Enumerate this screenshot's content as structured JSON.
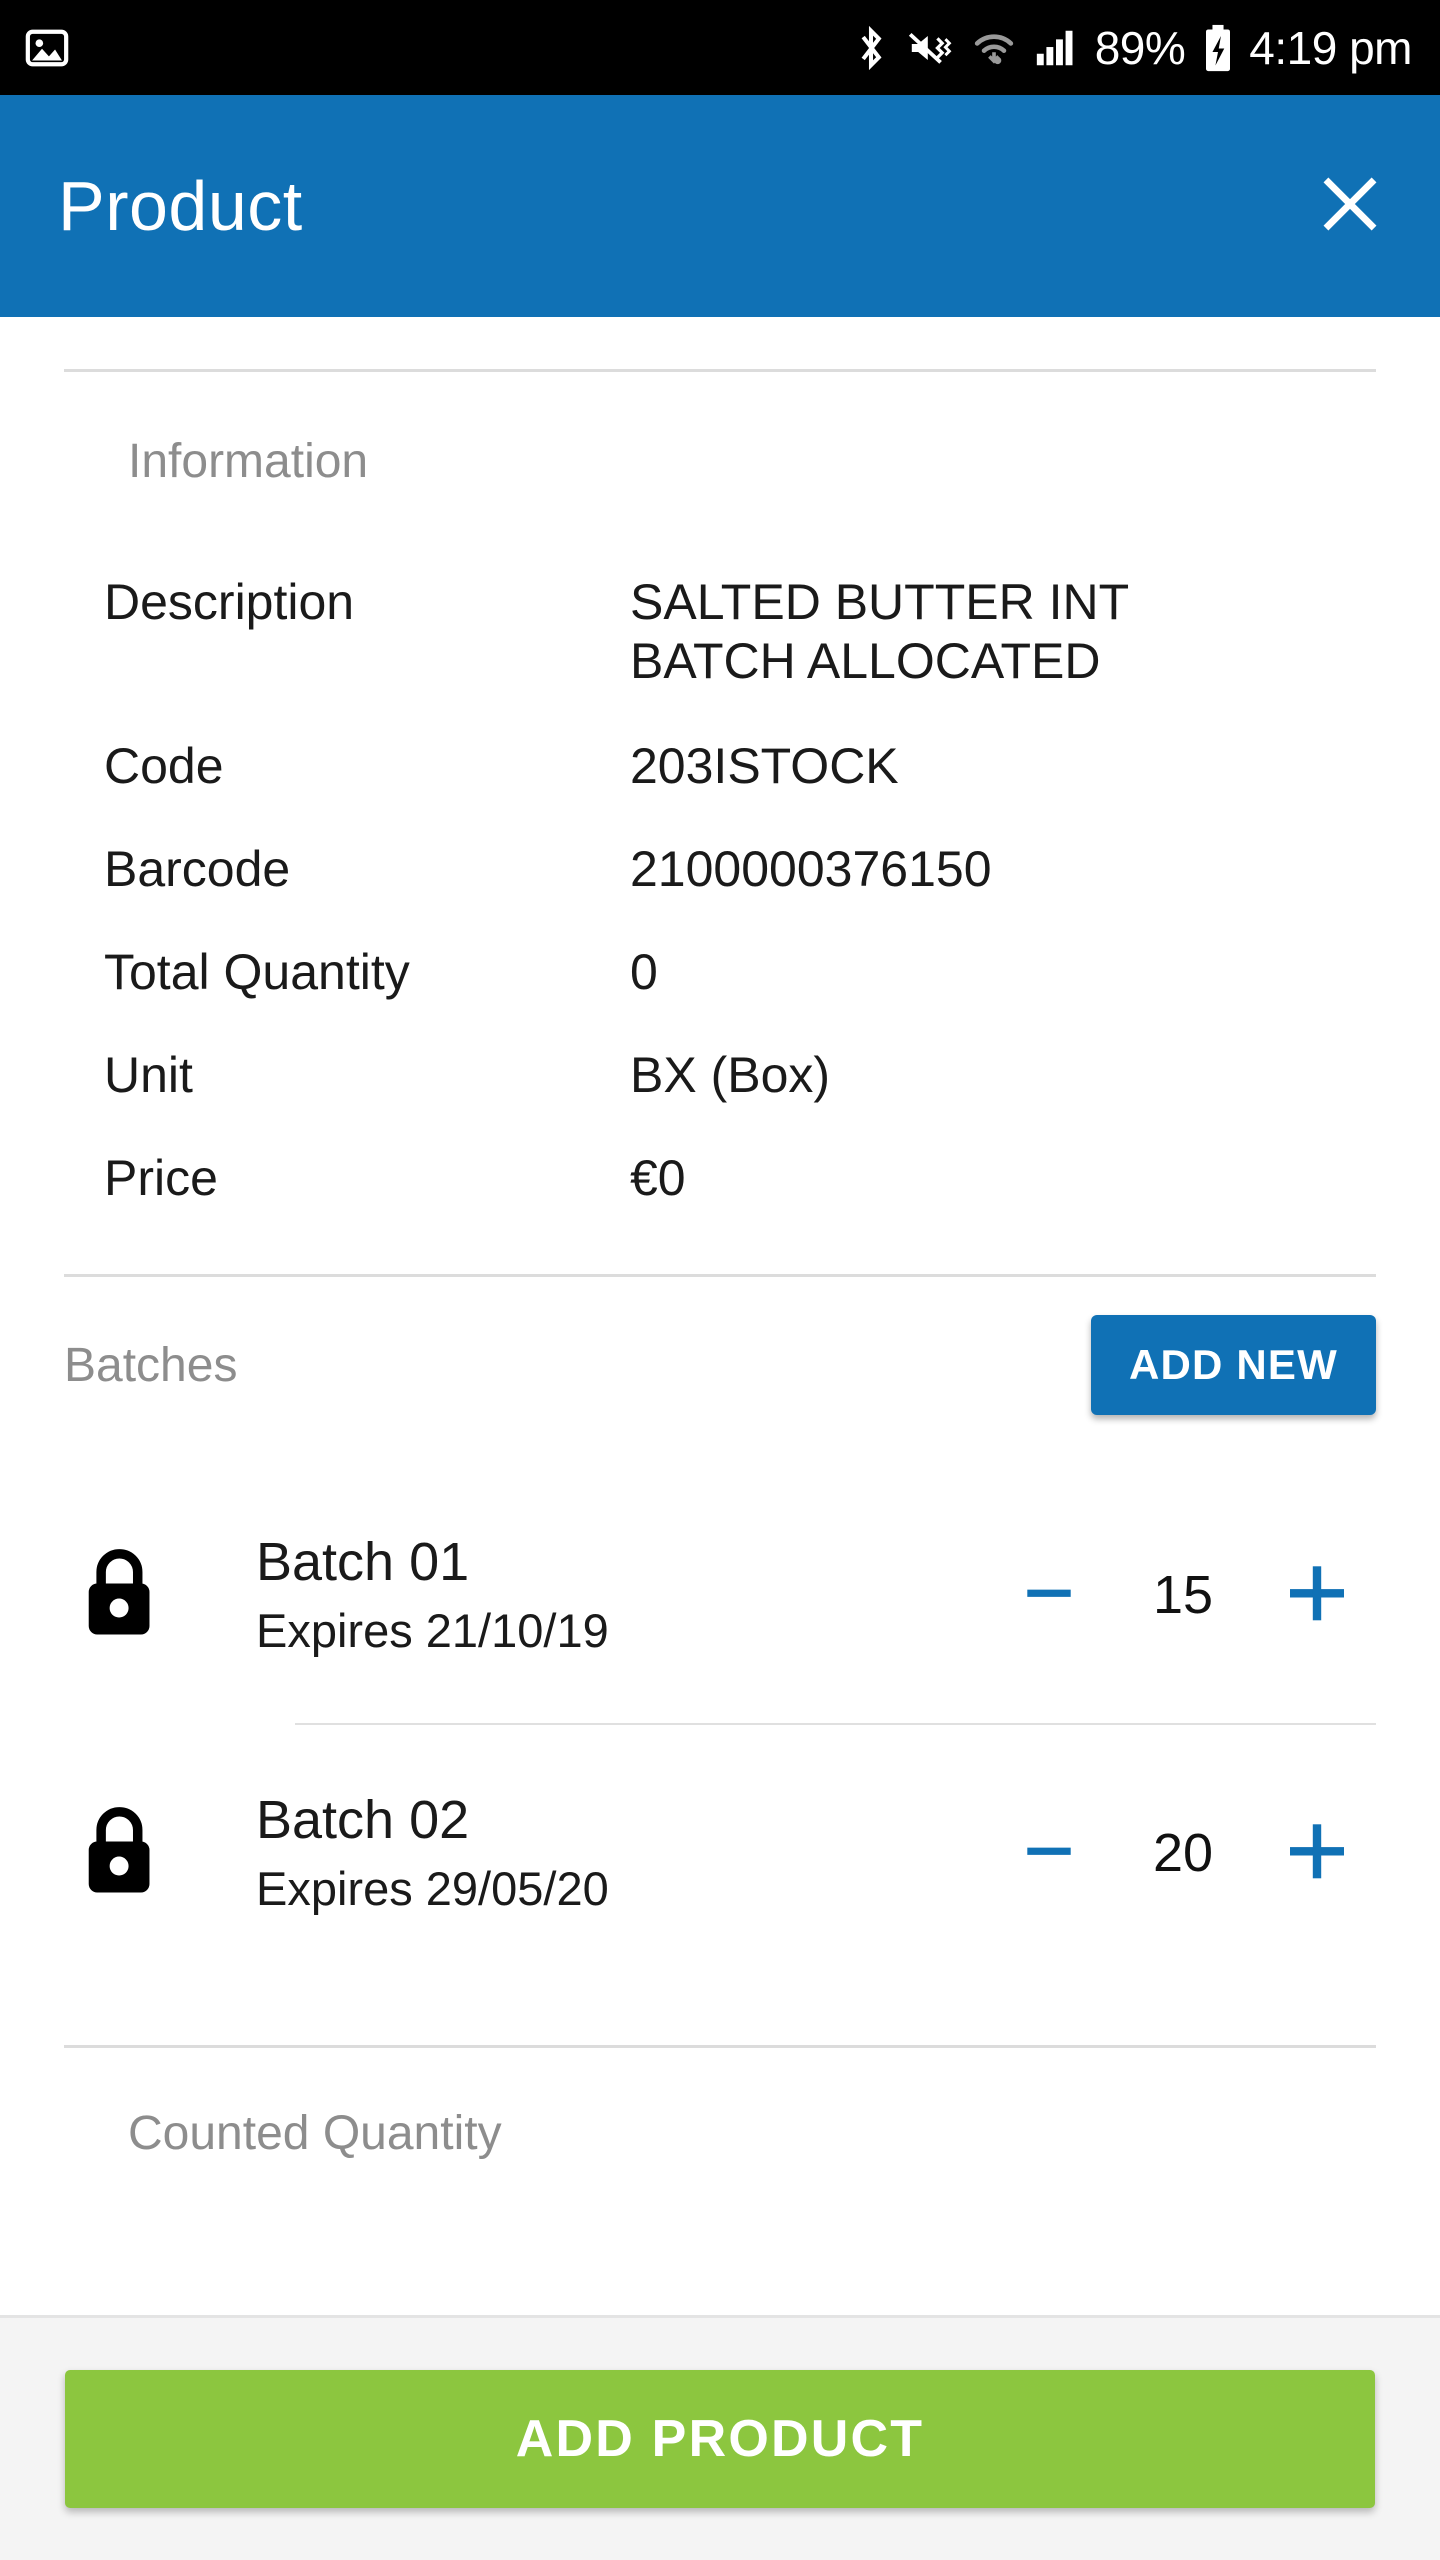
{
  "status_bar": {
    "notification_icon": "photo-icon",
    "bluetooth_icon": "bluetooth-icon",
    "mute_vibrate_icon": "mute-vibrate-icon",
    "wifi_icon": "wifi-icon",
    "signal_icon": "cellular-signal-icon",
    "battery_percent": "89%",
    "battery_icon": "battery-charging-icon",
    "time": "4:19 pm"
  },
  "app_bar": {
    "title": "Product",
    "close_icon": "close-icon"
  },
  "information": {
    "section_title": "Information",
    "rows": [
      {
        "label": "Description",
        "value": "SALTED BUTTER INT\nBATCH ALLOCATED"
      },
      {
        "label": "Code",
        "value": "203ISTOCK"
      },
      {
        "label": "Barcode",
        "value": "2100000376150"
      },
      {
        "label": "Total Quantity",
        "value": "0"
      },
      {
        "label": "Unit",
        "value": "BX (Box)"
      },
      {
        "label": "Price",
        "value": "€0"
      }
    ]
  },
  "batches": {
    "section_title": "Batches",
    "add_new_label": "ADD NEW",
    "items": [
      {
        "lock_icon": "unlocked-padlock-icon",
        "name": "Batch 01",
        "expiry": "Expires 21/10/19",
        "decrement_icon": "minus-icon",
        "quantity": "15",
        "increment_icon": "plus-icon"
      },
      {
        "lock_icon": "unlocked-padlock-icon",
        "name": "Batch 02",
        "expiry": "Expires 29/05/20",
        "decrement_icon": "minus-icon",
        "quantity": "20",
        "increment_icon": "plus-icon"
      }
    ]
  },
  "counted_quantity": {
    "section_title": "Counted Quantity"
  },
  "footer": {
    "add_product_label": "ADD PRODUCT"
  },
  "colors": {
    "app_bar_blue": "#1071b5",
    "accent_blue": "#1071b5",
    "primary_green": "#8cc63f",
    "muted_text": "#8d8d8d",
    "divider": "#dcdcdc",
    "footer_bg": "#f4f4f4"
  }
}
